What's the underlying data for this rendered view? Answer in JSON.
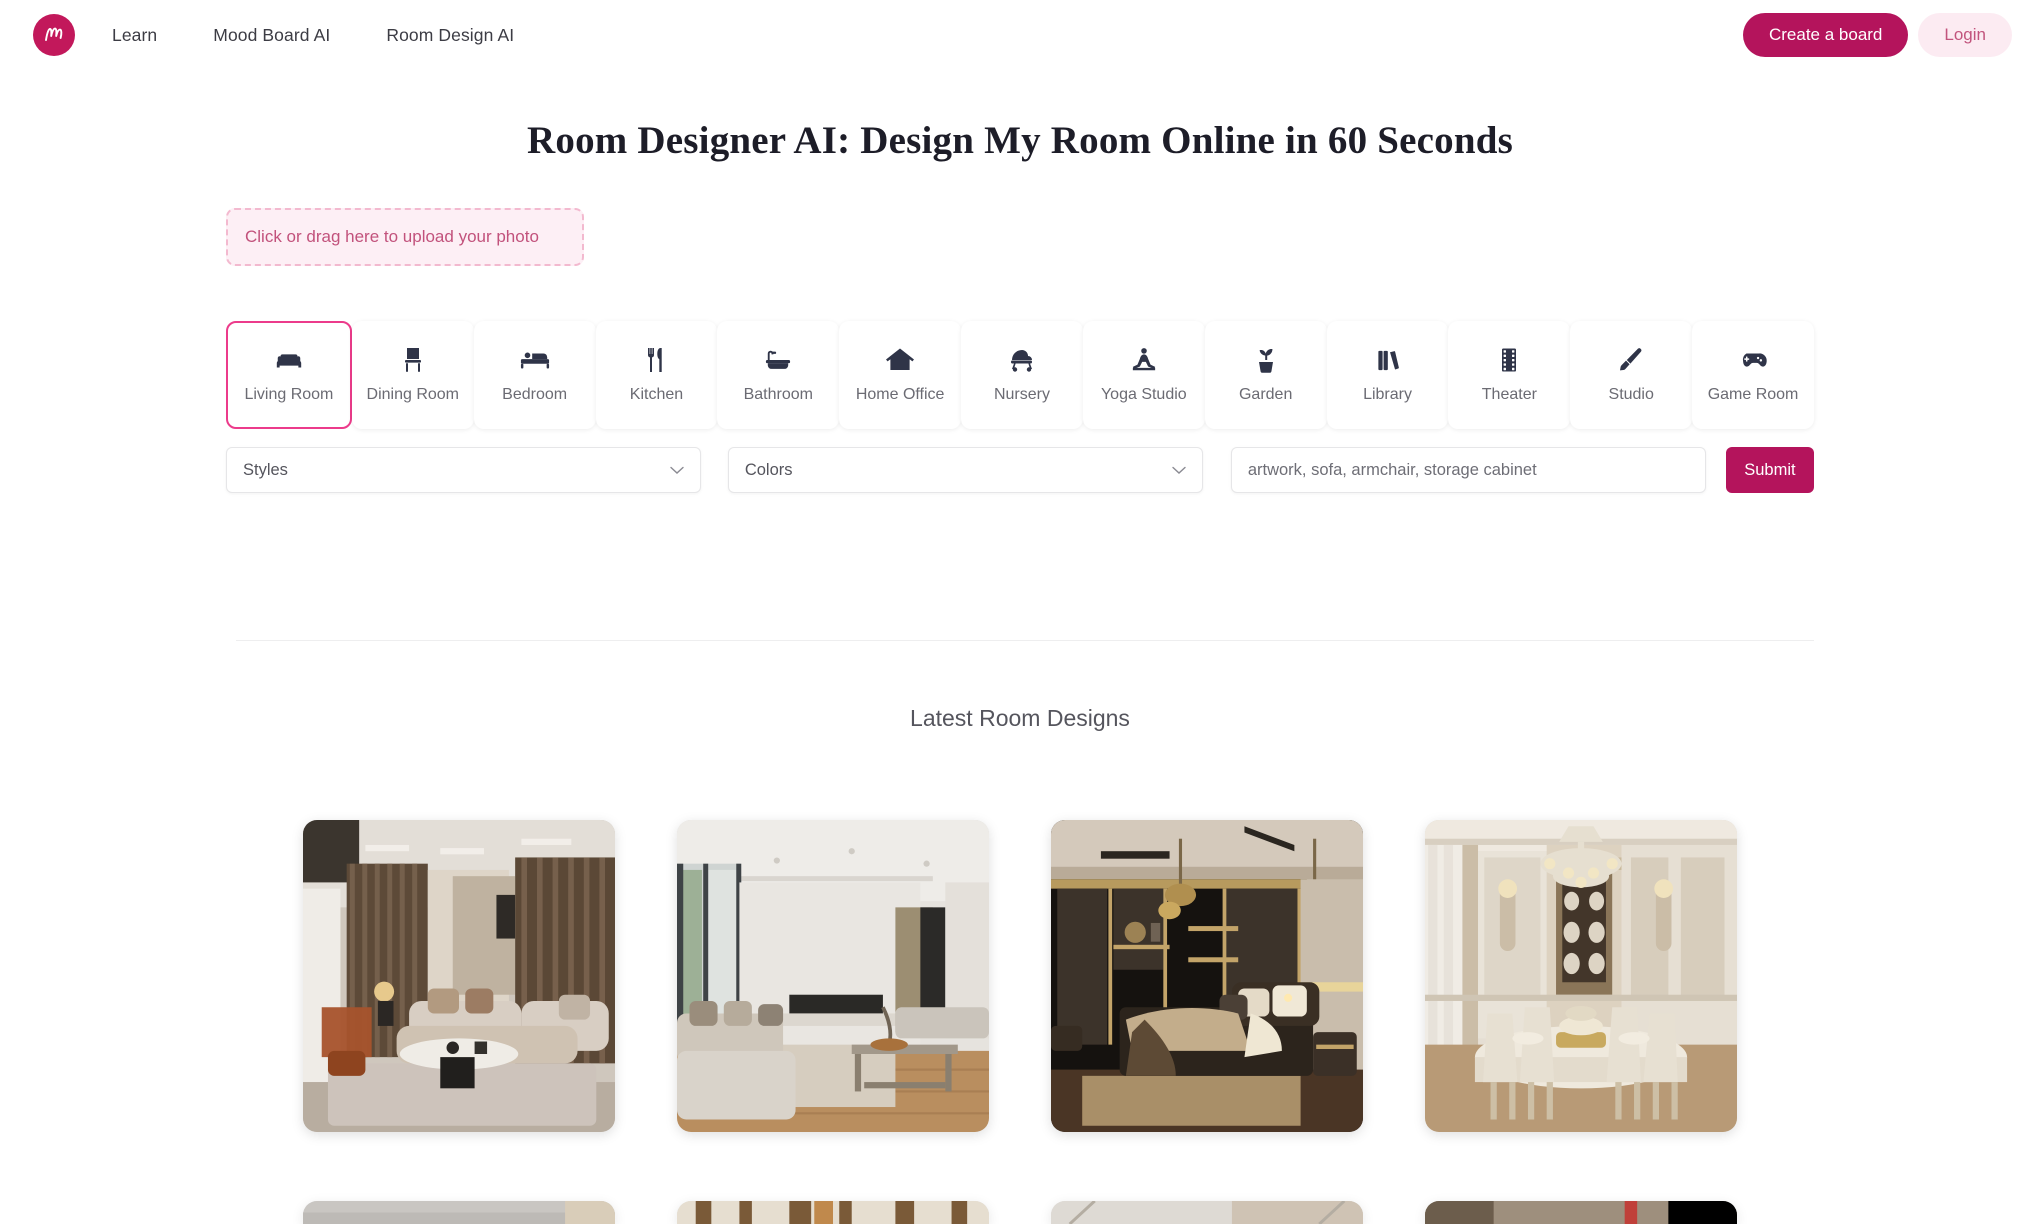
{
  "header": {
    "logo_name": "moodboard-logo",
    "nav": [
      {
        "label": "Learn"
      },
      {
        "label": "Mood Board AI"
      },
      {
        "label": "Room Design AI"
      }
    ],
    "create_board_label": "Create a board",
    "login_label": "Login",
    "brand_color": "#b4145c",
    "login_bg_color": "#fcebf2"
  },
  "page_title": "Room Designer AI: Design My Room Online in 60 Seconds",
  "upload": {
    "label": "Click or drag here to upload your photo",
    "border_color": "#f3b9cf",
    "bg_color": "#fdeff5",
    "text_color": "#c2527c"
  },
  "room_tabs": {
    "selected_index": 0,
    "selected_border_color": "#ec3b8b",
    "items": [
      {
        "label": "Living Room",
        "icon": "sofa-icon"
      },
      {
        "label": "Dining Room",
        "icon": "dining-chair-icon"
      },
      {
        "label": "Bedroom",
        "icon": "bed-icon"
      },
      {
        "label": "Kitchen",
        "icon": "fork-knife-icon"
      },
      {
        "label": "Bathroom",
        "icon": "bathtub-icon"
      },
      {
        "label": "Home Office",
        "icon": "house-icon"
      },
      {
        "label": "Nursery",
        "icon": "stroller-icon"
      },
      {
        "label": "Yoga Studio",
        "icon": "yoga-person-icon"
      },
      {
        "label": "Garden",
        "icon": "potted-plant-icon"
      },
      {
        "label": "Library",
        "icon": "books-icon"
      },
      {
        "label": "Theater",
        "icon": "film-strip-icon"
      },
      {
        "label": "Studio",
        "icon": "paintbrush-icon"
      },
      {
        "label": "Game Room",
        "icon": "gamepad-icon"
      }
    ]
  },
  "form": {
    "styles_select": {
      "value": "Styles",
      "chevron": "chevron-down-icon"
    },
    "colors_select": {
      "value": "Colors",
      "chevron": "chevron-down-icon"
    },
    "keywords_input": {
      "value": "",
      "placeholder": "artwork, sofa, armchair, storage cabinet"
    },
    "submit_label": "Submit",
    "submit_color": "#b4145c"
  },
  "gallery": {
    "title": "Latest Room Designs",
    "items": [
      {
        "name": "modern-luxury-living-room",
        "alt": "Modern luxury living room with brown curtains, curved beige sofa and marble coffee table"
      },
      {
        "name": "minimalist-living-room",
        "alt": "Minimalist living room with linear fireplace, large windows and wooden floor"
      },
      {
        "name": "dark-luxury-bedroom",
        "alt": "Dark luxury bedroom with black wardrobe, gold trim and pendant lights"
      },
      {
        "name": "classic-dining-room",
        "alt": "Classic French dining room with chandelier, china cabinet and upholstered chairs"
      }
    ],
    "items_row2": [
      {
        "name": "gallery-item-5",
        "alt": "Partially visible room design"
      },
      {
        "name": "gallery-item-6",
        "alt": "Partially visible room design"
      },
      {
        "name": "gallery-item-7",
        "alt": "Partially visible room design"
      },
      {
        "name": "gallery-item-8",
        "alt": "Partially visible room design"
      }
    ]
  }
}
